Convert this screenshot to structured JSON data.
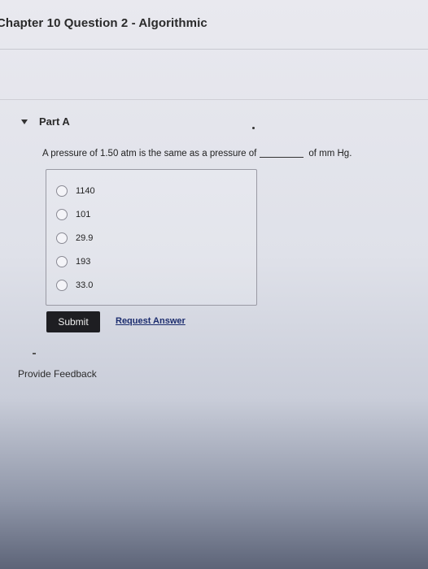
{
  "header": {
    "title": "Chapter 10 Question 2 - Algorithmic"
  },
  "part": {
    "label": "Part A",
    "question_before": "A pressure of 1.50 atm is the same as a pressure of",
    "question_after": "of mm Hg."
  },
  "options": [
    {
      "label": "1140"
    },
    {
      "label": "101"
    },
    {
      "label": "29.9"
    },
    {
      "label": "193"
    },
    {
      "label": "33.0"
    }
  ],
  "actions": {
    "submit_label": "Submit",
    "request_label": "Request Answer"
  },
  "footer": {
    "feedback_label": "Provide Feedback"
  },
  "icons": {
    "part_toggle": "caret-down-icon",
    "radio": "radio-empty-icon"
  },
  "colors": {
    "submit_bg": "#1e1e22",
    "link": "#1b2c6e"
  }
}
